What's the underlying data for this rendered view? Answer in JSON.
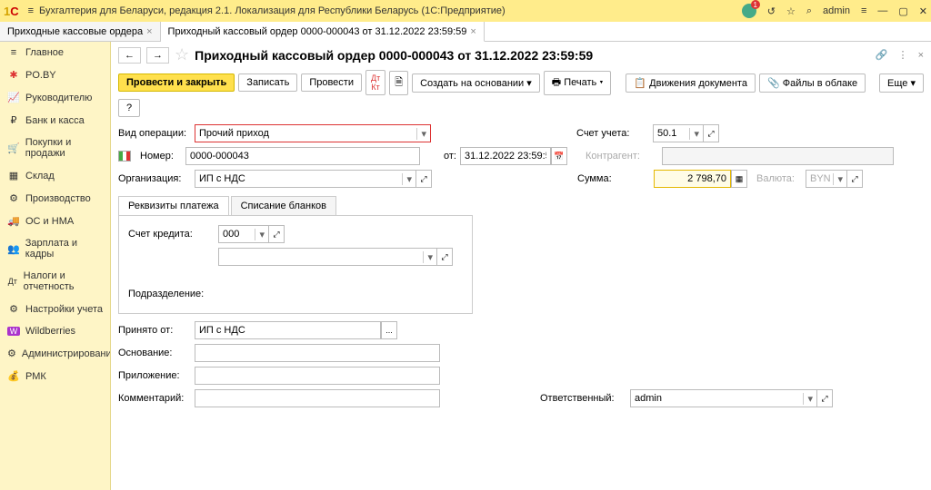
{
  "titlebar": {
    "logo": "1С",
    "title": "Бухгалтерия для Беларуси, редакция 2.1. Локализация для Республики Беларусь  (1С:Предприятие)",
    "user": "admin",
    "notif_count": "1"
  },
  "tabs": [
    {
      "label": "Приходные кассовые ордера"
    },
    {
      "label": "Приходный кассовый ордер 0000-000043 от 31.12.2022 23:59:59"
    }
  ],
  "sidebar": [
    {
      "icon": "≡",
      "label": "Главное"
    },
    {
      "icon": "✱",
      "label": "PO.BY",
      "color": "#d33"
    },
    {
      "icon": "⟋",
      "label": "Руководителю"
    },
    {
      "icon": "₽",
      "label": "Банк и касса"
    },
    {
      "icon": "🛒",
      "label": "Покупки и продажи"
    },
    {
      "icon": "▦",
      "label": "Склад"
    },
    {
      "icon": "⚙",
      "label": "Производство"
    },
    {
      "icon": "🚚",
      "label": "ОС и НМА"
    },
    {
      "icon": "👥",
      "label": "Зарплата и кадры"
    },
    {
      "icon": "Дт",
      "label": "Налоги и отчетность"
    },
    {
      "icon": "⚙",
      "label": "Настройки учета"
    },
    {
      "icon": "W",
      "label": "Wildberries",
      "bg": "#a3c"
    },
    {
      "icon": "⚙",
      "label": "Администрирование"
    },
    {
      "icon": "💰",
      "label": "РМК"
    }
  ],
  "doc": {
    "title": "Приходный кассовый ордер 0000-000043 от 31.12.2022 23:59:59"
  },
  "toolbar": {
    "post_close": "Провести и закрыть",
    "save": "Записать",
    "post": "Провести",
    "create_based": "Создать на основании",
    "print": "Печать",
    "movements": "Движения документа",
    "files": "Файлы в облаке",
    "more": "Еще",
    "help": "?"
  },
  "fields": {
    "op_type_label": "Вид операции:",
    "op_type": "Прочий приход",
    "account_label": "Счет учета:",
    "account": "50.1",
    "number_label": "Номер:",
    "number": "0000-000043",
    "date_label": "от:",
    "date": "31.12.2022 23:59:59",
    "counterparty_label": "Контрагент:",
    "counterparty": "",
    "org_label": "Организация:",
    "org": "ИП с НДС",
    "sum_label": "Сумма:",
    "sum": "2 798,70",
    "currency_label": "Валюта:",
    "currency": "BYN",
    "credit_account_label": "Счет кредита:",
    "credit_account": "000",
    "subdivision_label": "Подразделение:",
    "from_label": "Принято от:",
    "from": "ИП с НДС",
    "basis_label": "Основание:",
    "attachment_label": "Приложение:",
    "comment_label": "Комментарий:",
    "responsible_label": "Ответственный:",
    "responsible": "admin"
  },
  "inner_tabs": {
    "tab1": "Реквизиты платежа",
    "tab2": "Списание бланков"
  }
}
